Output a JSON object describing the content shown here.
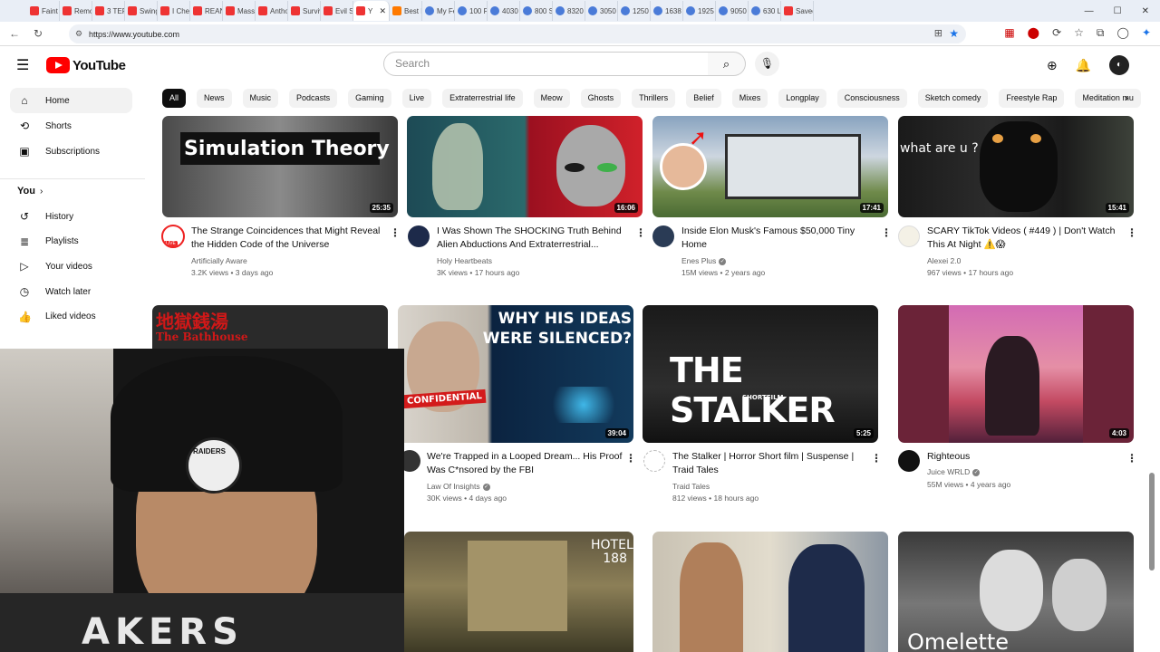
{
  "browser": {
    "tabs": [
      "Faint",
      "Remo",
      "3 TER",
      "Swing",
      "I Chec",
      "REAN",
      "Massi",
      "Antho",
      "Surviv",
      "Evil Sp",
      "Y",
      "Best H",
      "My Fe",
      "100 F",
      "4030",
      "800 S",
      "8320",
      "3050",
      "1250",
      "1638",
      "1925",
      "9050",
      "630 L",
      "Saved"
    ],
    "active_tab_index": 10,
    "url": "https://www.youtube.com"
  },
  "masthead": {
    "logo_text": "YouTube",
    "search_placeholder": "Search"
  },
  "sidebar": {
    "top_items": [
      {
        "label": "Home",
        "icon": "home-icon",
        "glyph": "⌂"
      },
      {
        "label": "Shorts",
        "icon": "shorts-icon",
        "glyph": "⟲"
      },
      {
        "label": "Subscriptions",
        "icon": "subscriptions-icon",
        "glyph": "▣"
      }
    ],
    "you_label": "You",
    "you_items": [
      {
        "label": "History",
        "icon": "history-icon",
        "glyph": "↺"
      },
      {
        "label": "Playlists",
        "icon": "playlists-icon",
        "glyph": "≣"
      },
      {
        "label": "Your videos",
        "icon": "your-videos-icon",
        "glyph": "▷"
      },
      {
        "label": "Watch later",
        "icon": "watch-later-icon",
        "glyph": "◷"
      },
      {
        "label": "Liked videos",
        "icon": "liked-videos-icon",
        "glyph": "👍"
      }
    ]
  },
  "chips": [
    "All",
    "News",
    "Music",
    "Podcasts",
    "Gaming",
    "Live",
    "Extraterrestrial life",
    "Meow",
    "Ghosts",
    "Thrillers",
    "Belief",
    "Mixes",
    "Longplay",
    "Consciousness",
    "Sketch comedy",
    "Freestyle Rap",
    "Meditation mu"
  ],
  "videos_row1": [
    {
      "title": "The Strange Coincidences that Might Reveal the Hidden Code of the Universe",
      "channel": "Artificially Aware",
      "verified": false,
      "meta": "3.2K views • 3 days ago",
      "duration": "25:35",
      "thumb_text": "Simulation Theory",
      "avatar_text": "LIVE"
    },
    {
      "title": "I Was Shown The SHOCKING Truth Behind Alien Abductions And Extraterrestrial...",
      "channel": "Holy Heartbeats",
      "verified": false,
      "meta": "3K views • 17 hours ago",
      "duration": "16:06",
      "thumb_text": "",
      "avatar_text": ""
    },
    {
      "title": "Inside Elon Musk's Famous $50,000 Tiny Home",
      "channel": "Enes Plus",
      "verified": true,
      "meta": "15M views • 2 years ago",
      "duration": "17:41",
      "thumb_text": "",
      "avatar_text": ""
    },
    {
      "title": "SCARY TikTok Videos ( #449 ) | Don't Watch This At Night ⚠️😱",
      "channel": "Alexei 2.0",
      "verified": false,
      "meta": "967 views • 17 hours ago",
      "duration": "15:41",
      "thumb_text": "what are u ?",
      "avatar_text": ""
    }
  ],
  "videos_row2": [
    {
      "title": "",
      "channel": "",
      "verified": false,
      "meta": "",
      "duration": "",
      "thumb_text": "地獄銭湯",
      "thumb_subtext": "The Bathhouse"
    },
    {
      "title": "We're Trapped in a Looped Dream... His Proof Was C*nsored by the FBI",
      "channel": "Law Of Insights",
      "verified": true,
      "meta": "30K views • 4 days ago",
      "duration": "39:04",
      "thumb_text": "WHY HIS IDEAS WERE SILENCED?",
      "thumb_subtext": "CONFIDENTIAL"
    },
    {
      "title": "The Stalker | Horror Short film | Suspense | Traid Tales",
      "channel": "Traid Tales",
      "verified": false,
      "meta": "812 views • 18 hours ago",
      "duration": "5:25",
      "thumb_text": "THE STALKER",
      "thumb_subtext": "SHORTFILM"
    },
    {
      "title": "Righteous",
      "channel": "Juice WRLD",
      "verified": true,
      "meta": "55M views • 4 years ago",
      "duration": "4:03",
      "thumb_text": "",
      "thumb_subtext": ""
    }
  ],
  "videos_row3": [
    {
      "thumb_text": "HOTEL 188"
    },
    {
      "thumb_text": ""
    },
    {
      "thumb_text": "Omelette"
    }
  ],
  "webcam": {
    "hat_text": "RAIDERS",
    "shirt_text": "AKERS"
  },
  "colors": {
    "brand_red": "#ff0000",
    "chip_active": "#0f0f0f",
    "chip_bg": "#f2f2f2",
    "meta_gray": "#606060"
  }
}
